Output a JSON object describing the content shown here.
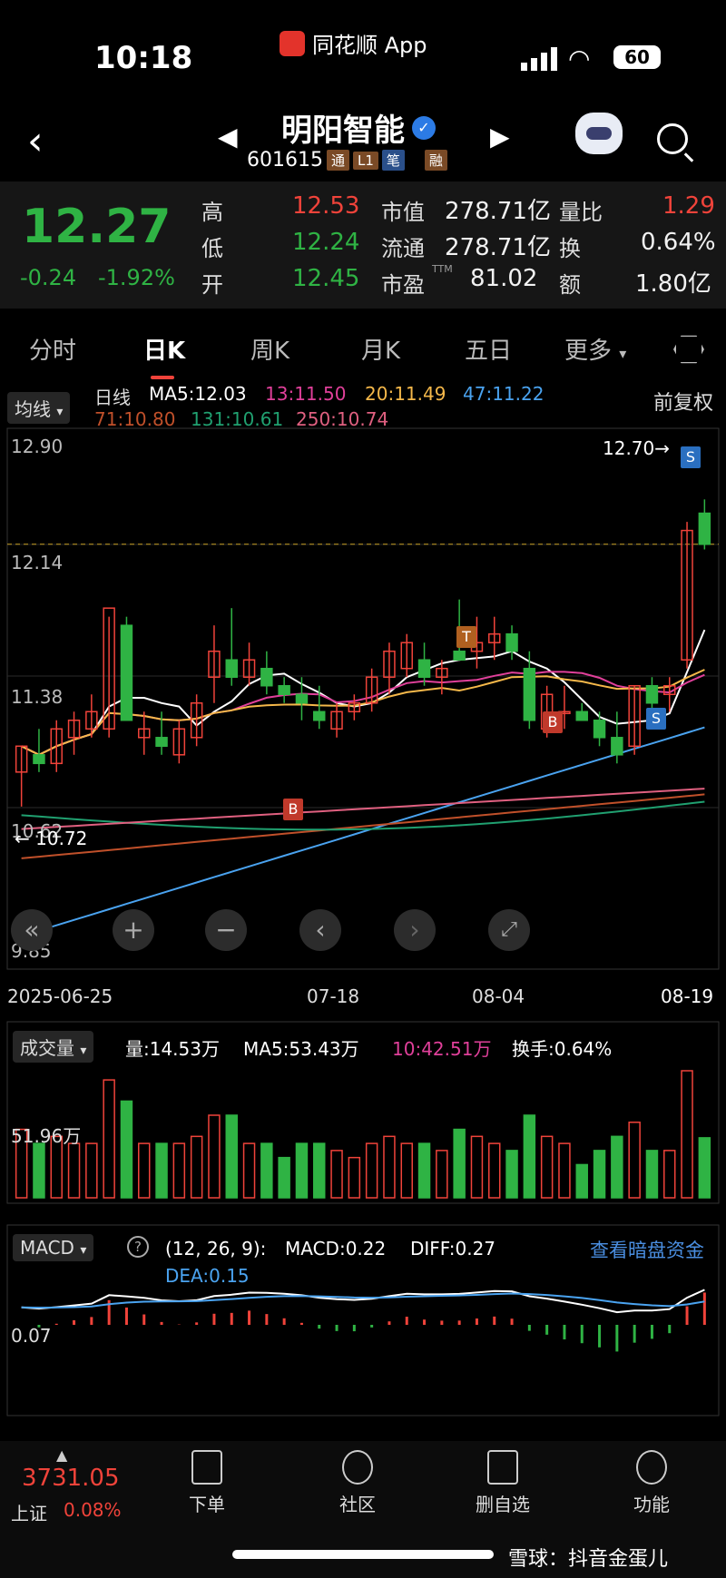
{
  "status": {
    "time": "10:18",
    "app_name": "同花顺 App",
    "battery": "60"
  },
  "nav": {
    "stock_name": "明阳智能",
    "code": "601615",
    "tags": [
      "通",
      "L1",
      "笔",
      "融"
    ]
  },
  "quote": {
    "price": "12.27",
    "change": "-0.24",
    "change_pct": "-1.92%",
    "high_label": "高",
    "high": "12.53",
    "low_label": "低",
    "low": "12.24",
    "open_label": "开",
    "open": "12.45",
    "mcap_label": "市值",
    "mcap": "278.71亿",
    "float_label": "流通",
    "float": "278.71亿",
    "pe_label": "市盈",
    "pe_sup": "TTM",
    "pe": "81.02",
    "vr_label": "量比",
    "vr": "1.29",
    "turn_label": "换",
    "turn": "0.64%",
    "amt_label": "额",
    "amt": "1.80亿"
  },
  "tabs": [
    "分时",
    "日K",
    "周K",
    "月K",
    "五日",
    "更多"
  ],
  "indicator": {
    "selector": "均线",
    "period": "日线",
    "adjust": "前复权",
    "ma5": "MA5:12.03",
    "ma13": "13:11.50",
    "ma20": "20:11.49",
    "ma47": "47:11.22",
    "ma71": "71:10.80",
    "ma131": "131:10.61",
    "ma250": "250:10.74"
  },
  "kline": {
    "y_labels": [
      "12.90",
      "12.14",
      "11.38",
      "10.62",
      "9.85"
    ],
    "high_marker": "12.70→",
    "low_marker": "10.72",
    "dates": [
      "2025-06-25",
      "07-18",
      "08-04",
      "08-19"
    ],
    "markers": [
      "B",
      "T",
      "B",
      "S",
      "S"
    ],
    "colors": {
      "up": "#f0433a",
      "down": "#2fb344",
      "ma5": "#ffffff",
      "ma13": "#e0409a",
      "ma20": "#f5b84a",
      "ma47": "#4aa3f0",
      "ma71": "#c0502a",
      "ma131": "#20a070",
      "ma250": "#e06080"
    }
  },
  "chart_data": {
    "type": "candlestick",
    "title": "",
    "ylim": [
      9.85,
      12.9
    ],
    "x": [
      "06-25",
      "06-26",
      "06-27",
      "06-30",
      "07-01",
      "07-02",
      "07-03",
      "07-04",
      "07-07",
      "07-08",
      "07-09",
      "07-10",
      "07-11",
      "07-14",
      "07-15",
      "07-16",
      "07-17",
      "07-18",
      "07-21",
      "07-22",
      "07-23",
      "07-24",
      "07-25",
      "07-28",
      "07-29",
      "07-30",
      "07-31",
      "08-01",
      "08-04",
      "08-05",
      "08-06",
      "08-07",
      "08-08",
      "08-11",
      "08-12",
      "08-13",
      "08-14",
      "08-15",
      "08-18",
      "08-19"
    ],
    "ohlc": [
      [
        10.95,
        11.1,
        10.75,
        11.1
      ],
      [
        11.05,
        11.2,
        10.95,
        11.0
      ],
      [
        11.0,
        11.25,
        10.95,
        11.2
      ],
      [
        11.15,
        11.3,
        11.05,
        11.25
      ],
      [
        11.2,
        11.4,
        11.15,
        11.3
      ],
      [
        11.2,
        11.85,
        11.15,
        11.9
      ],
      [
        11.8,
        11.85,
        11.3,
        11.25
      ],
      [
        11.15,
        11.3,
        11.05,
        11.2
      ],
      [
        11.15,
        11.3,
        11.05,
        11.1
      ],
      [
        11.05,
        11.25,
        11.0,
        11.2
      ],
      [
        11.15,
        11.4,
        11.1,
        11.35
      ],
      [
        11.5,
        11.8,
        11.35,
        11.65
      ],
      [
        11.6,
        11.9,
        11.45,
        11.5
      ],
      [
        11.5,
        11.7,
        11.45,
        11.6
      ],
      [
        11.55,
        11.65,
        11.4,
        11.45
      ],
      [
        11.45,
        11.5,
        11.35,
        11.4
      ],
      [
        11.4,
        11.5,
        11.25,
        11.35
      ],
      [
        11.3,
        11.45,
        11.2,
        11.25
      ],
      [
        11.2,
        11.35,
        11.15,
        11.3
      ],
      [
        11.3,
        11.4,
        11.25,
        11.35
      ],
      [
        11.35,
        11.55,
        11.3,
        11.5
      ],
      [
        11.5,
        11.7,
        11.4,
        11.65
      ],
      [
        11.55,
        11.75,
        11.5,
        11.7
      ],
      [
        11.6,
        11.7,
        11.45,
        11.5
      ],
      [
        11.5,
        11.6,
        11.4,
        11.55
      ],
      [
        11.65,
        11.95,
        11.6,
        11.6
      ],
      [
        11.65,
        11.85,
        11.55,
        11.7
      ],
      [
        11.7,
        11.85,
        11.6,
        11.75
      ],
      [
        11.75,
        11.8,
        11.6,
        11.65
      ],
      [
        11.55,
        11.65,
        11.2,
        11.25
      ],
      [
        11.2,
        11.45,
        11.15,
        11.4
      ],
      [
        11.3,
        11.45,
        11.2,
        11.3
      ],
      [
        11.3,
        11.35,
        11.25,
        11.25
      ],
      [
        11.25,
        11.3,
        11.1,
        11.15
      ],
      [
        11.15,
        11.3,
        11.0,
        11.05
      ],
      [
        11.1,
        11.45,
        11.05,
        11.45
      ],
      [
        11.45,
        11.5,
        11.3,
        11.35
      ],
      [
        11.4,
        11.5,
        11.3,
        11.45
      ],
      [
        11.6,
        12.4,
        11.55,
        12.35
      ],
      [
        12.45,
        12.53,
        12.24,
        12.27
      ]
    ],
    "volume": {
      "label": "成交量",
      "vol": "量:14.53万",
      "ma5": "MA5:53.43万",
      "ma10": "10:42.51万",
      "turnover": "换手:0.64%",
      "ref": "51.96万"
    },
    "macd": {
      "label": "MACD",
      "params": "(12, 26, 9):",
      "macd": "MACD:0.22",
      "diff": "DIFF:0.27",
      "dea": "DEA:0.15",
      "ref": "0.07",
      "link": "查看暗盘资金"
    }
  },
  "bottom": {
    "index_value": "3731.05",
    "index_name": "上证",
    "index_pct": "0.08%",
    "items": [
      "下单",
      "社区",
      "删自选",
      "功能"
    ],
    "watermark": "雪球：抖音金蛋儿"
  }
}
